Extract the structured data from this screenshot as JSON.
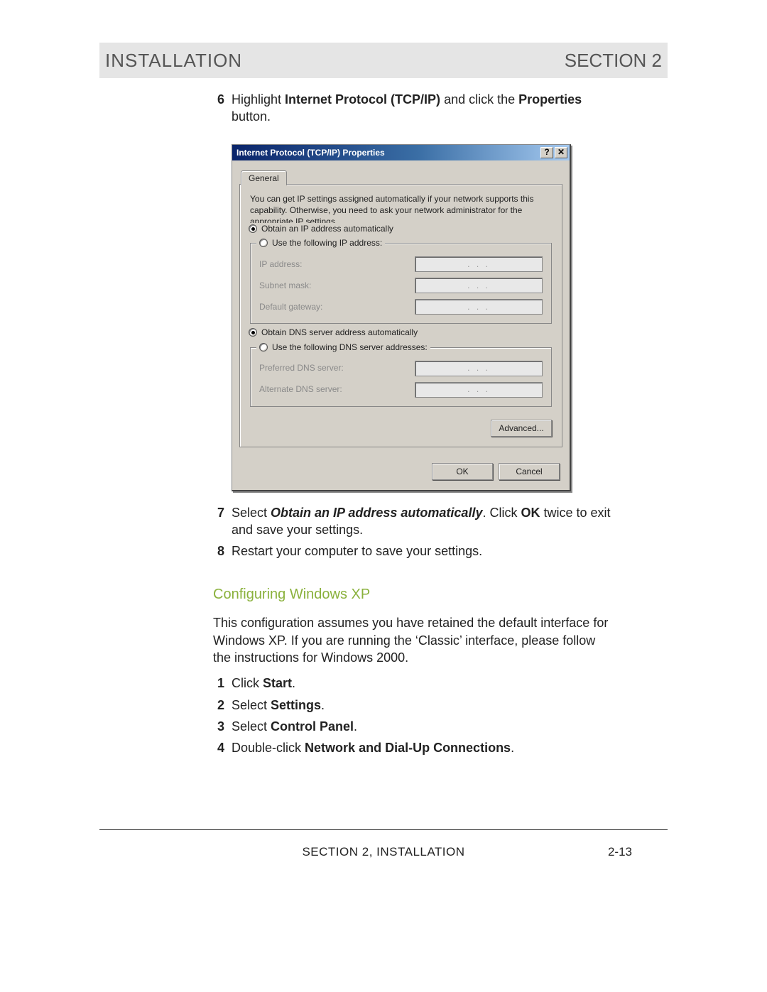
{
  "header": {
    "left": "INSTALLATION",
    "right": "SECTION 2"
  },
  "steps_a": [
    {
      "n": "6",
      "html": "Highlight <b>Internet Protocol (TCP/IP)</b> and click the <b>Properties</b> button."
    }
  ],
  "dialog": {
    "title": "Internet Protocol (TCP/IP) Properties",
    "help_btn": "?",
    "close_btn": "✕",
    "tab": "General",
    "intro": "You can get IP settings assigned automatically if your network supports this capability. Otherwise, you need to ask your network administrator for the appropriate IP settings.",
    "ip_group": {
      "opt_auto": "Obtain an IP address automatically",
      "opt_manual": "Use the following IP address:",
      "fields": {
        "ip": "IP address:",
        "mask": "Subnet mask:",
        "gw": "Default gateway:"
      }
    },
    "dns_group": {
      "opt_auto": "Obtain DNS server address automatically",
      "opt_manual": "Use the following DNS server addresses:",
      "fields": {
        "pref": "Preferred DNS server:",
        "alt": "Alternate DNS server:"
      }
    },
    "ip_placeholder": ".     .     .",
    "advanced_btn": "Advanced...",
    "ok_btn": "OK",
    "cancel_btn": "Cancel"
  },
  "steps_b": [
    {
      "n": "7",
      "html": "Select <b><i>Obtain an IP address automatically</i></b>. Click <b>OK</b> twice to exit and save your settings."
    },
    {
      "n": "8",
      "html": "Restart your computer to save your settings."
    }
  ],
  "subhead": "Configuring Windows XP",
  "xp_intro": "This configuration assumes you have retained the default interface for Windows XP. If you are running the ‘Classic’ interface, please follow the instructions for Windows 2000.",
  "steps_c": [
    {
      "n": "1",
      "html": "Click <b>Start</b>."
    },
    {
      "n": "2",
      "html": "Select <b>Settings</b>."
    },
    {
      "n": "3",
      "html": "Select <b>Control Panel</b>."
    },
    {
      "n": "4",
      "html": "Double-click <b>Network and Dial-Up Connections</b>."
    }
  ],
  "footer": {
    "center": "SECTION 2, INSTALLATION",
    "page": "2-13"
  }
}
